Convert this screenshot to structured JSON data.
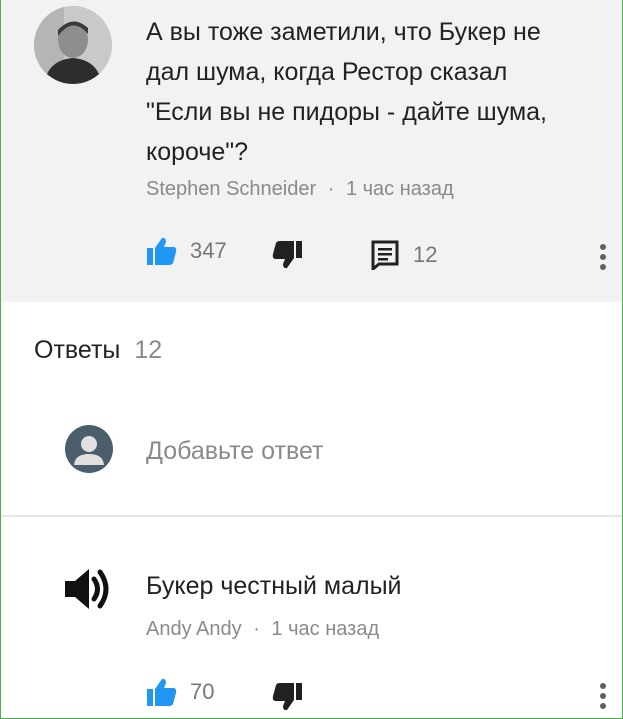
{
  "comment": {
    "text_lines": [
      "А вы тоже заметили, что Букер не",
      "дал шума, когда Рестор сказал",
      "\"Если вы не пидоры - дайте шума,",
      "короче\"?"
    ],
    "author": "Stephen Schneider",
    "separator": "·",
    "time": "1 час назад",
    "likes": "347",
    "replies_count": "12"
  },
  "replies_section": {
    "label": "Ответы",
    "count": "12",
    "add_reply_placeholder": "Добавьте ответ"
  },
  "reply": {
    "text": "Букер честный малый",
    "author": "Andy Andy",
    "separator": "·",
    "time": "1 час назад",
    "likes": "70"
  },
  "colors": {
    "like_blue": "#2196f3",
    "icon_dark": "#212121",
    "muted": "#8a8a8a",
    "top_bg": "#f2f2f2"
  }
}
